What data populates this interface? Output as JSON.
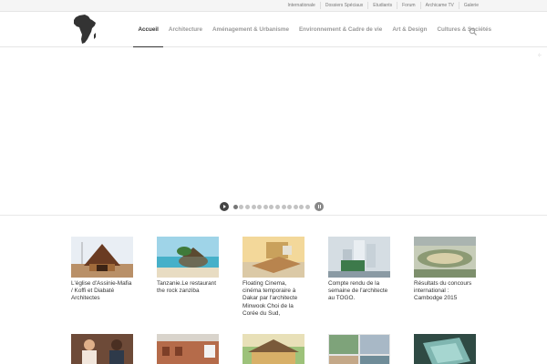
{
  "topbar": {
    "links": [
      "Internationale",
      "Dossiers Spéciaux",
      "Etudiants",
      "Forum",
      "Archicame TV",
      "Galerie"
    ]
  },
  "header": {
    "nav": [
      "Accueil",
      "Architecture",
      "Aménagement & Urbanisme",
      "Environnement & Cadre de vie",
      "Art & Design",
      "Cultures & Sociétés"
    ],
    "active_index": 0
  },
  "slider": {
    "dot_count": 13,
    "active_dot": 0
  },
  "articles": [
    {
      "title": "L'église d'Assinie-Mafia / Koffi et Diabaté Architectes"
    },
    {
      "title": "Tanzanie.Le restaurant the rock zanziba"
    },
    {
      "title": "Floating Cinema, cinéma temporaire à Dakar par l'architecte Minwook Choi de la Corée du Sud,"
    },
    {
      "title": "Compte rendu de la semaine de l'architecte au TOGO."
    },
    {
      "title": "Résultats du concours international : Cambodge 2015"
    },
    {
      "title": ""
    },
    {
      "title": ""
    },
    {
      "title": ""
    },
    {
      "title": ""
    },
    {
      "title": ""
    }
  ]
}
